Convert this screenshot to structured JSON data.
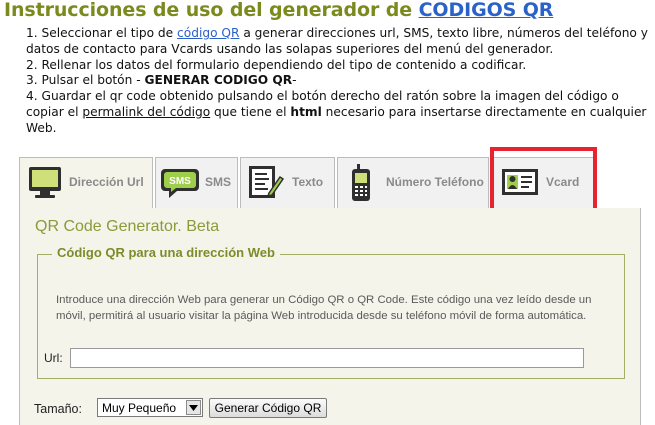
{
  "header": {
    "title_prefix": "Instrucciones de uso del generador de ",
    "title_link": "CODIGOS QR"
  },
  "instructions": {
    "step1_a": "1. Seleccionar el tipo de ",
    "step1_link": "código QR",
    "step1_b": " a generar direcciones url,  SMS, texto libre, números del teléfono y datos de contacto para Vcards usando las solapas superiores del menú del generador.",
    "step2": "2. Rellenar los datos del formulario dependiendo del tipo de contenido a codificar.",
    "step3_a": "3. Pulsar el botón - ",
    "step3_b": "GENERAR CODIGO QR",
    "step3_c": "-",
    "step4_a": "4. Guardar el qr code obtenido pulsando el botón derecho del ratón sobre la imagen del código o copiar el ",
    "step4_link": "permalink del código",
    "step4_b": " que tiene el ",
    "step4_bold": "html",
    "step4_c": " necesario para insertarse directamente en cualquier Web."
  },
  "tabs": [
    {
      "label": "Dirección Url",
      "icon": "monitor-icon",
      "active": true
    },
    {
      "label": "SMS",
      "icon": "sms-bubble-icon",
      "active": false
    },
    {
      "label": "Texto",
      "icon": "text-document-icon",
      "active": false
    },
    {
      "label": "Número Teléfono",
      "icon": "mobile-phone-icon",
      "active": false
    },
    {
      "label": "Vcard",
      "icon": "contact-card-icon",
      "active": false
    }
  ],
  "panel": {
    "title": "QR Code Generator. Beta",
    "legend": "Código QR para una dirección Web",
    "description": "Introduce una dirección Web para generar un Código QR o QR Code. Este código una vez leído desde un móvil, permitirá al usuario visitar la página Web introducida desde su teléfono móvil de forma automática.",
    "url_label": "Url:",
    "url_value": "",
    "size_label": "Tamaño:",
    "size_selected": "Muy Pequeño",
    "generate_button": "Generar Código QR"
  },
  "colors": {
    "accent_olive": "#7a8a1c",
    "link_blue": "#2a62c8",
    "highlight_red": "#e8222e",
    "panel_bg": "#f4f4ea"
  }
}
